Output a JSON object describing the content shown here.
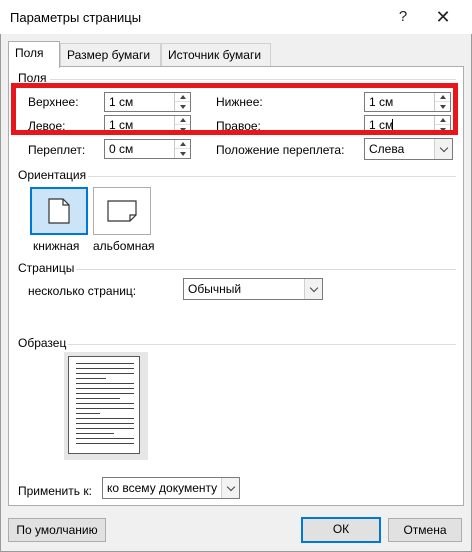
{
  "window": {
    "title": "Параметры страницы",
    "help": "?",
    "close": "✕"
  },
  "tabs": [
    {
      "label": "Поля",
      "active": true
    },
    {
      "label": "Размер бумаги",
      "active": false
    },
    {
      "label": "Источник бумаги",
      "active": false
    }
  ],
  "margins": {
    "group_label": "Поля",
    "top_label": "Верхнее:",
    "top_value": "1 см",
    "bottom_label": "Нижнее:",
    "bottom_value": "1 см",
    "left_label": "Левое:",
    "left_value": "1 см",
    "right_label": "Правое:",
    "right_value": "1 см",
    "gutter_label": "Переплет:",
    "gutter_value": "0 см",
    "gutter_pos_label": "Положение переплета:",
    "gutter_pos_value": "Слева"
  },
  "orientation": {
    "group_label": "Ориентация",
    "portrait_label": "книжная",
    "landscape_label": "альбомная",
    "selected": "portrait"
  },
  "pages": {
    "group_label": "Страницы",
    "multiple_label": "несколько страниц:",
    "multiple_value": "Обычный"
  },
  "preview": {
    "group_label": "Образец"
  },
  "apply": {
    "label": "Применить к:",
    "value": "ко всему документу"
  },
  "footer": {
    "default_label": "По умолчанию",
    "ok_label": "ОК",
    "cancel_label": "Отмена"
  },
  "highlight_color": "#e8151b",
  "accent": "#0078d7"
}
